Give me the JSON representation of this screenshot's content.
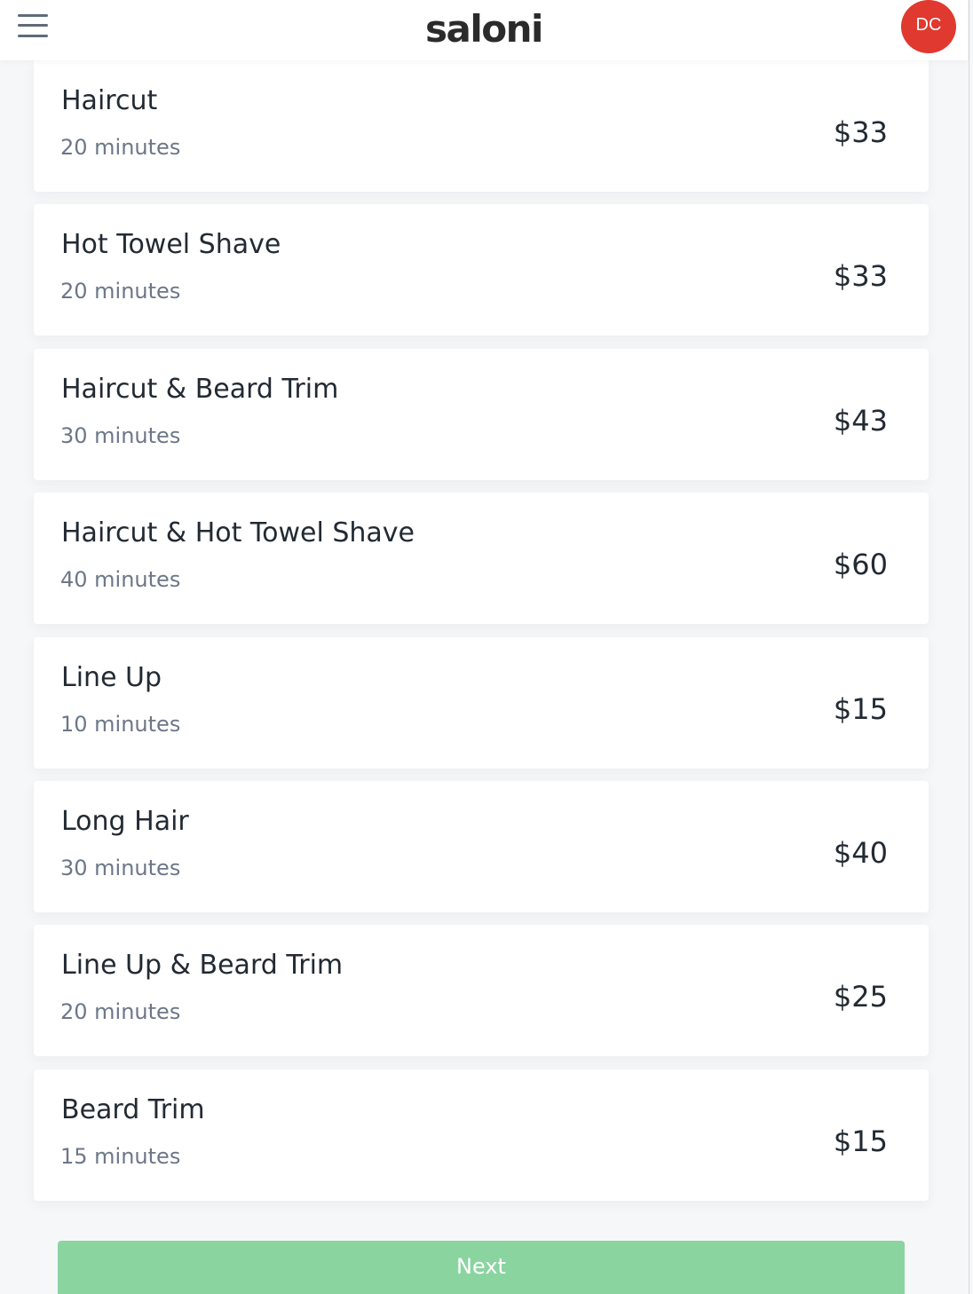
{
  "header": {
    "logo": "saloni",
    "avatar_initials": "DC",
    "avatar_color": "#e0392f"
  },
  "services": [
    {
      "name": "Haircut",
      "duration": "20 minutes",
      "price": "$33"
    },
    {
      "name": "Hot Towel Shave",
      "duration": "20 minutes",
      "price": "$33"
    },
    {
      "name": "Haircut & Beard Trim",
      "duration": "30 minutes",
      "price": "$43"
    },
    {
      "name": "Haircut & Hot Towel Shave",
      "duration": "40 minutes",
      "price": "$60"
    },
    {
      "name": "Line Up",
      "duration": "10 minutes",
      "price": "$15"
    },
    {
      "name": "Long Hair",
      "duration": "30 minutes",
      "price": "$40"
    },
    {
      "name": "Line Up & Beard Trim",
      "duration": "20 minutes",
      "price": "$25"
    },
    {
      "name": "Beard Trim",
      "duration": "15 minutes",
      "price": "$15"
    }
  ],
  "footer": {
    "next_label": "Next",
    "next_color": "#8ad4a0"
  }
}
